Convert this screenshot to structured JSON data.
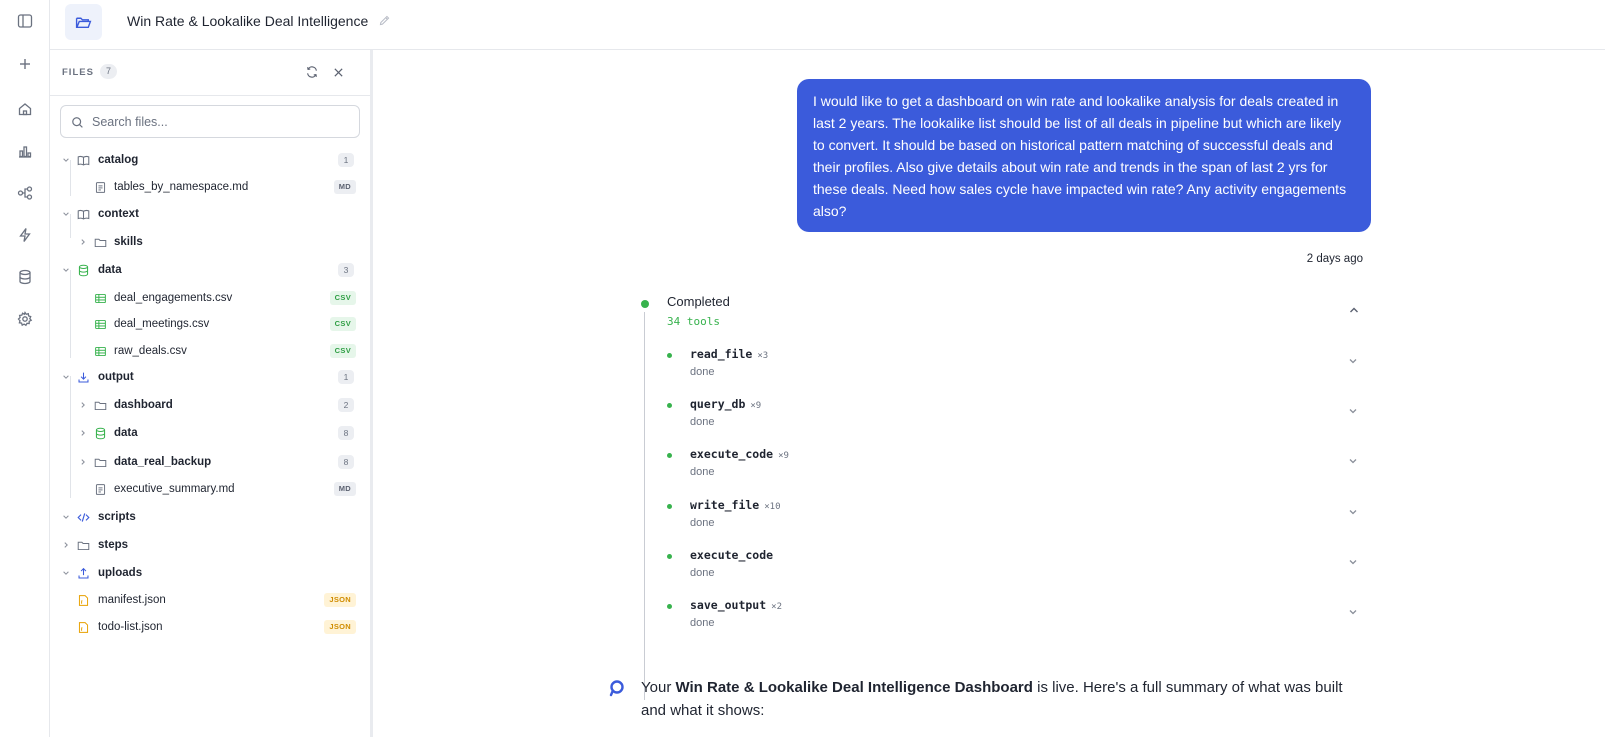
{
  "header": {
    "title": "Win Rate & Lookalike Deal Intelligence"
  },
  "files": {
    "label": "FILES",
    "count": "7",
    "search_placeholder": "Search files...",
    "tree": [
      {
        "name": "catalog",
        "count": "1"
      },
      {
        "name": "tables_by_namespace.md",
        "badge": "MD"
      },
      {
        "name": "context"
      },
      {
        "name": "skills"
      },
      {
        "name": "data",
        "count": "3"
      },
      {
        "name": "deal_engagements.csv",
        "badge": "CSV"
      },
      {
        "name": "deal_meetings.csv",
        "badge": "CSV"
      },
      {
        "name": "raw_deals.csv",
        "badge": "CSV"
      },
      {
        "name": "output",
        "count": "1"
      },
      {
        "name": "dashboard",
        "count": "2"
      },
      {
        "name": "data",
        "count": "8"
      },
      {
        "name": "data_real_backup",
        "count": "8"
      },
      {
        "name": "executive_summary.md",
        "badge": "MD"
      },
      {
        "name": "scripts"
      },
      {
        "name": "steps"
      },
      {
        "name": "uploads"
      },
      {
        "name": "manifest.json",
        "badge": "JSON"
      },
      {
        "name": "todo-list.json",
        "badge": "JSON"
      }
    ]
  },
  "chat": {
    "user_message": "I would like to get a dashboard on win rate and lookalike analysis for deals created in last 2 years. The lookalike list should be list of all deals in pipeline but which are likely to convert. It should be based on historical pattern matching of successful deals and their profiles. Also give details about win rate and trends in the span of last 2 yrs for these deals. Need how sales cycle have impacted win rate? Any activity engagements also?",
    "timestamp": "2 days ago",
    "run": {
      "status": "Completed",
      "tool_count": "34 tools",
      "tools": [
        {
          "name": "read_file",
          "mult": "×3",
          "status": "done"
        },
        {
          "name": "query_db",
          "mult": "×9",
          "status": "done"
        },
        {
          "name": "execute_code",
          "mult": "×9",
          "status": "done"
        },
        {
          "name": "write_file",
          "mult": "×10",
          "status": "done"
        },
        {
          "name": "execute_code",
          "mult": "",
          "status": "done"
        },
        {
          "name": "save_output",
          "mult": "×2",
          "status": "done"
        }
      ]
    },
    "answer": {
      "prefix": "Your ",
      "bold": "Win Rate & Lookalike Deal Intelligence Dashboard",
      "suffix": " is live. Here's a full summary of what was built and what it shows:"
    }
  },
  "colors": {
    "accent": "#3b5bdb",
    "success": "#37b24d",
    "json_badge": "#d08c00"
  }
}
